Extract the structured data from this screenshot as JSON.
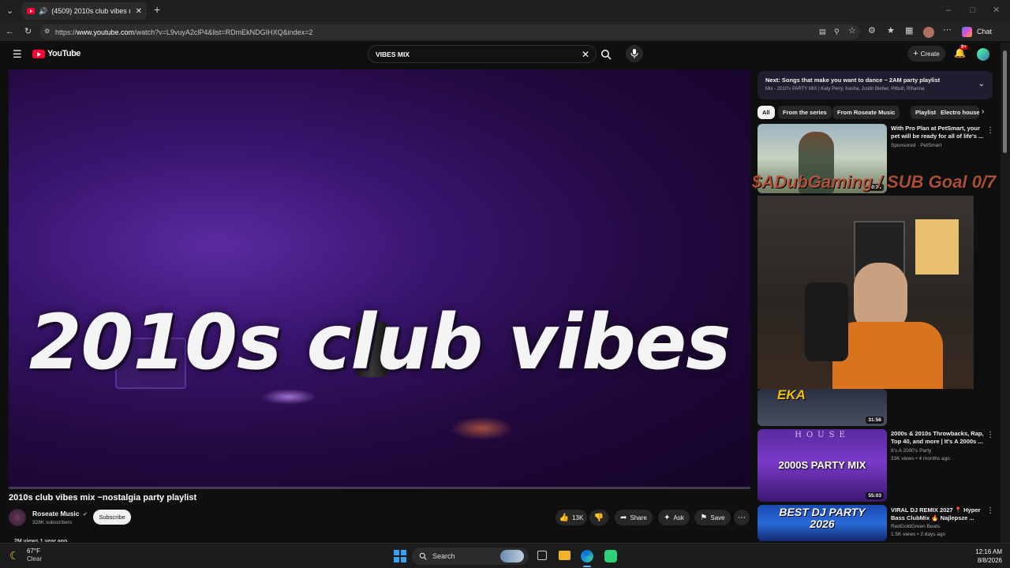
{
  "browser": {
    "tab_title": "(4509) 2010s club vibes mix ~",
    "url_prefix": "https://",
    "url_host": "www.youtube.com",
    "url_path": "/watch?v=L9vuyA2clP4&list=RDmEkNDGIHXQ&index=2",
    "chat_label": "Chat"
  },
  "youtube": {
    "logo_text": "YouTube",
    "search_value": "VIBES MIX",
    "create_label": "Create",
    "notif_badge": "9+"
  },
  "video": {
    "overlay_title": "2010s club vibes",
    "title": "2010s club vibes mix ~nostalgia party playlist",
    "channel": "Roseate Music",
    "subscribers": "328K subscribers",
    "subscribe_label": "Subscribe",
    "views_line": "2M views  1 year ago",
    "likes": "13K",
    "share_label": "Share",
    "ask_label": "Ask",
    "save_label": "Save"
  },
  "sidebar": {
    "next_prefix": "Next:",
    "next_title": "Songs that make you want to dance ~ 2AM party playlist",
    "next_sub": "Mix - 2010's PARTY MIX | Katy Perry, Kesha, Justin Bieber, Pitbull, Rihanna",
    "chips": [
      "All",
      "From the series",
      "From Roseate Music",
      "Playlists",
      "Electro house"
    ],
    "items": [
      {
        "title": "With Pro Plan at PetSmart, your pet will be ready for all of life's ...",
        "line1": "Sponsored · PetSmart",
        "line2": "",
        "duration": "0:31"
      },
      {
        "title": "",
        "line1": "",
        "line2": "",
        "duration": "31:56"
      },
      {
        "title": "2000s & 2010s Throwbacks, Rap, Top 40, and more | It's A 2000s ...",
        "line1": "It's A 2000's Party",
        "line2": "33K views • 4 months ago",
        "duration": "55:03",
        "thumb_text": "2000S PARTY MIX",
        "thumb_top": "HOUSE"
      },
      {
        "title": "VIRAL DJ REMIX 2027 📍 Hyper Bass ClubMix 🔥 Najlepsze ...",
        "line1": "RedGoldGreen Beats",
        "line2": "1.5K views • 2 days ago",
        "duration": "",
        "thumb_text": "BEST DJ PARTY 2026"
      }
    ],
    "webcam_overlay": "$ADubGaming / SUB Goal 0/7",
    "webcam_sign": "EKA"
  },
  "taskbar": {
    "temp": "67°F",
    "weather": "Clear",
    "search_label": "Search",
    "time": "12:16 AM",
    "date": "8/8/2026"
  }
}
